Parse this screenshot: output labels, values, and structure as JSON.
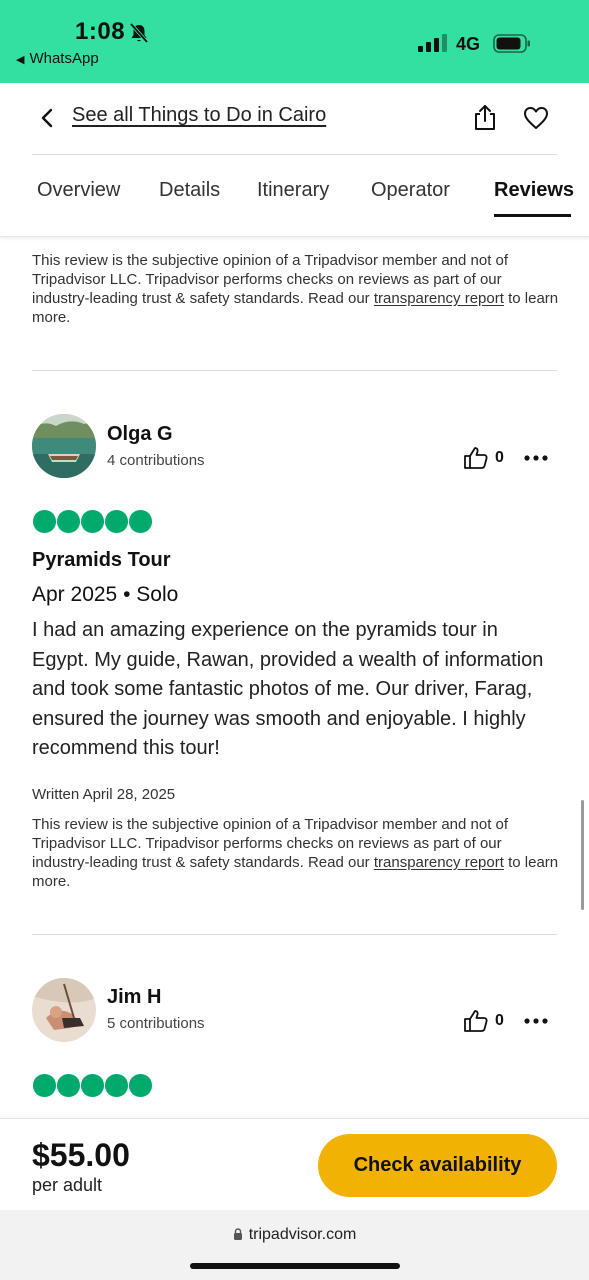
{
  "status_bar": {
    "time": "1:08",
    "back_app": "WhatsApp",
    "network": "4G"
  },
  "header": {
    "back_link": "See all Things to Do in Cairo"
  },
  "tabs": [
    {
      "label": "Overview"
    },
    {
      "label": "Details"
    },
    {
      "label": "Itinerary"
    },
    {
      "label": "Operator"
    },
    {
      "label": "Reviews",
      "active": true
    }
  ],
  "disclaimer": {
    "text": "This review is the subjective opinion of a Tripadvisor member and not of Tripadvisor LLC. Tripadvisor performs checks on reviews as part of our industry-leading trust & safety standards. Read our ",
    "link": "transparency report",
    "suffix": " to learn more."
  },
  "reviews": [
    {
      "name": "Olga G",
      "contributions": "4 contributions",
      "helpful_count": "0",
      "rating": 5,
      "title": "Pyramids Tour",
      "meta": "Apr 2025 • Solo",
      "body": "I had an amazing experience on the pyramids tour in Egypt. My guide, Rawan, provided a wealth of information and took some fantastic photos of me. Our driver, Farag, ensured the journey was smooth and enjoyable. I highly recommend this tour!",
      "written": "Written April 28, 2025"
    },
    {
      "name": "Jim H",
      "contributions": "5 contributions",
      "helpful_count": "0",
      "rating": 5
    }
  ],
  "booking": {
    "price": "$55.00",
    "unit": "per adult",
    "button": "Check availability"
  },
  "browser": {
    "url": "tripadvisor.com"
  },
  "colors": {
    "status_bar": "#34e0a1",
    "rating_bubble": "#00aa6c",
    "cta": "#f2b203"
  }
}
